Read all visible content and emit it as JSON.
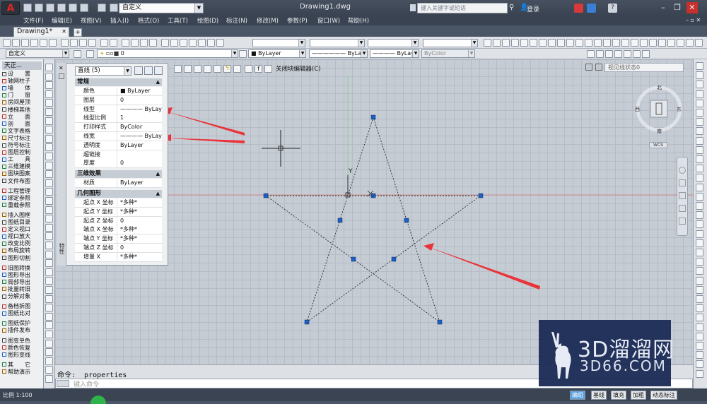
{
  "app": {
    "title": "Drawing1.dwg",
    "workspace": "自定义",
    "search_placeholder": "键入关键字或短语",
    "sign_in": "登录"
  },
  "menu": [
    "文件(F)",
    "编辑(E)",
    "视图(V)",
    "插入(I)",
    "格式(O)",
    "工具(T)",
    "绘图(D)",
    "标注(N)",
    "修改(M)",
    "参数(P)",
    "窗口(W)",
    "帮助(H)"
  ],
  "tabs": {
    "active": "Drawing1*",
    "add": "+"
  },
  "toolbar2": {
    "ucs_combo": "自定义",
    "layer_value": "0",
    "color": "ByLayer",
    "linetype": "ByLayer",
    "lineweight": "ByLayer",
    "plotstyle": "ByColor"
  },
  "left_palette": {
    "title": "天正...",
    "items": [
      "设　　置",
      "轴网柱子",
      "墙　　体",
      "门　　窗",
      "房间屋顶",
      "楼梯其他",
      "立　　面",
      "剖　　面",
      "文字表格",
      "尺寸标注",
      "符号标注",
      "图层控制",
      "工　　具",
      "三维建模",
      "图块图案",
      "文件布图",
      "工程管理",
      "绑定参照",
      "重载参照",
      "插入图框",
      "图纸目录",
      "定义视口",
      "视口放大",
      "改变比例",
      "布局旋转",
      "图形切割",
      "旧图转换",
      "图形导出",
      "局部导出",
      "批量转旧",
      "分解对象",
      "备档拆图",
      "图纸比对",
      "图纸保护",
      "插件发布",
      "图变单色",
      "颜色恢复",
      "图形变线",
      "其　　它",
      "帮助演示"
    ]
  },
  "properties": {
    "selection": "直线 (5)",
    "side_label": "特性",
    "sections": [
      {
        "title": "常规",
        "rows": [
          [
            "颜色",
            "■ ByLayer"
          ],
          [
            "图层",
            "0"
          ],
          [
            "线型",
            "———— ByLayer"
          ],
          [
            "线型比例",
            "1"
          ],
          [
            "打印样式",
            "ByColor"
          ],
          [
            "线宽",
            "———— ByLayer"
          ],
          [
            "透明度",
            "ByLayer"
          ],
          [
            "超链接",
            ""
          ],
          [
            "厚度",
            "0"
          ]
        ]
      },
      {
        "title": "三维效果",
        "rows": [
          [
            "材质",
            "ByLayer"
          ]
        ]
      },
      {
        "title": "几何图形",
        "rows": [
          [
            "起点 X 坐标",
            "*多种*"
          ],
          [
            "起点 Y 坐标",
            "*多种*"
          ],
          [
            "起点 Z 坐标",
            "0"
          ],
          [
            "端点 X 坐标",
            "*多种*"
          ],
          [
            "端点 Y 坐标",
            "*多种*"
          ],
          [
            "端点 Z 坐标",
            "0"
          ],
          [
            "增量 X",
            "*多种*"
          ]
        ]
      }
    ]
  },
  "canvas": {
    "block_editor": "关闭块编辑器(C)",
    "visual_style": "视见线状态0",
    "wcs": "WCS",
    "axis_label": "Y"
  },
  "command": {
    "history": "命令: _properties",
    "placeholder": "键入命令"
  },
  "status": {
    "scale": "比例 1:100",
    "toggles": [
      "编组",
      "基线",
      "填充",
      "加粗",
      "动态标注"
    ]
  },
  "watermark": {
    "line1": "3D溜溜网",
    "line2": "3D66.COM"
  },
  "colors": {
    "accent": "#5aa2e0",
    "arrow": "#e8343a",
    "grip": "#1f5fbf"
  }
}
